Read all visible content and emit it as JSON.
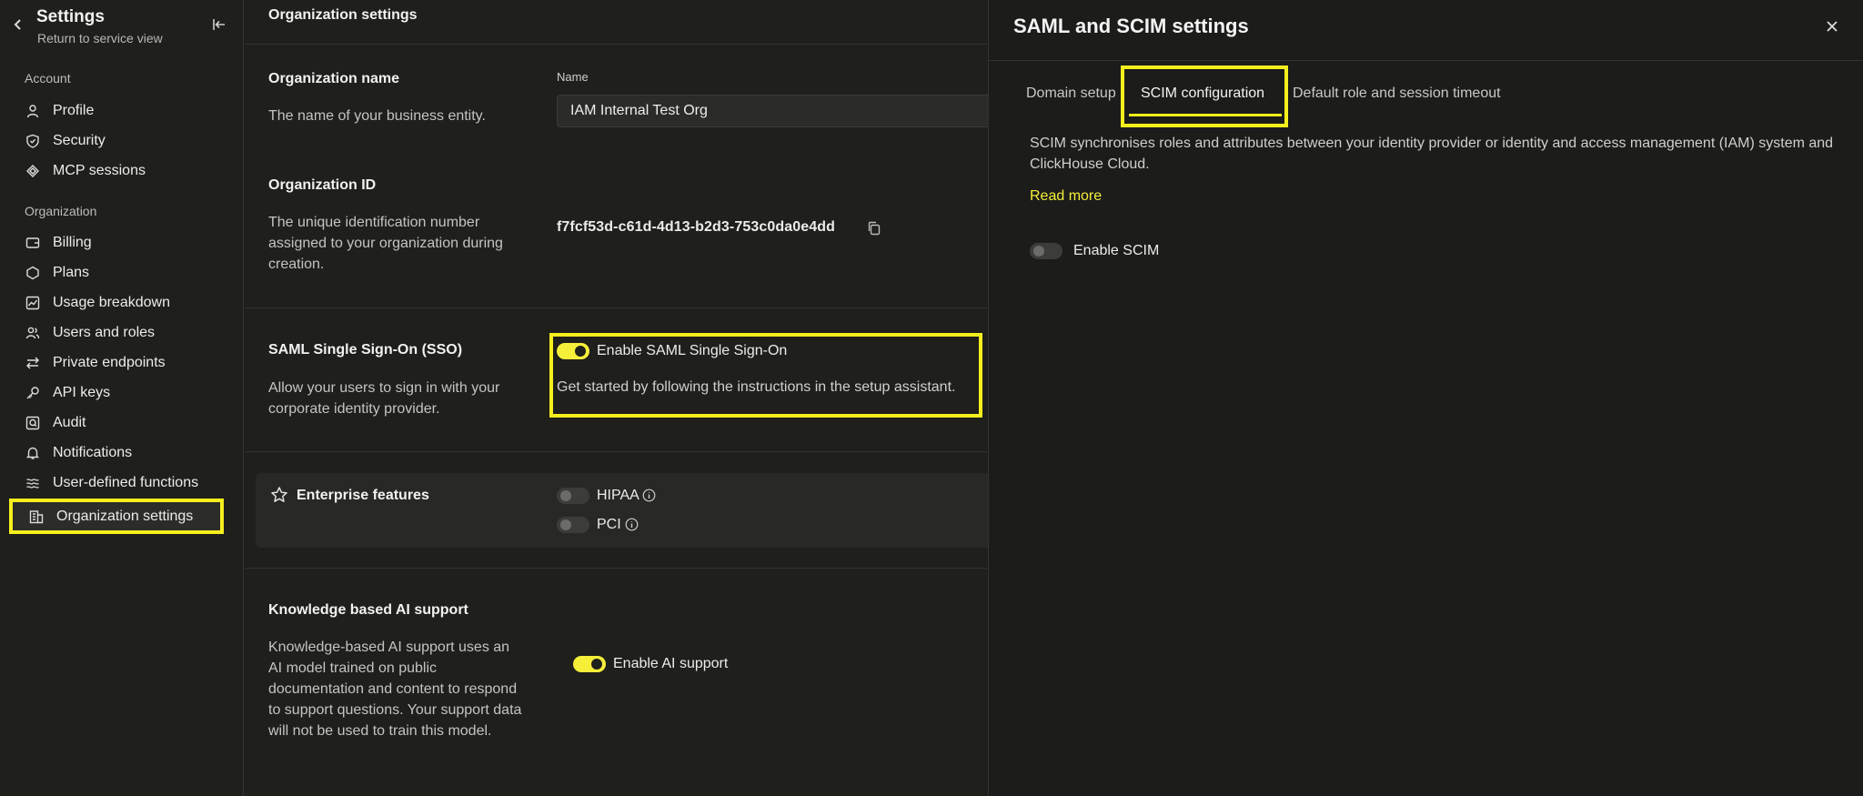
{
  "sidebar": {
    "title": "Settings",
    "subtitle": "Return to service view",
    "sections": {
      "account": "Account",
      "organization": "Organization"
    },
    "items": [
      {
        "label": "Profile",
        "icon": "user-icon"
      },
      {
        "label": "Security",
        "icon": "shield-icon"
      },
      {
        "label": "MCP sessions",
        "icon": "mcp-icon"
      },
      {
        "label": "Billing",
        "icon": "wallet-icon"
      },
      {
        "label": "Plans",
        "icon": "hexagon-icon"
      },
      {
        "label": "Usage breakdown",
        "icon": "chart-icon"
      },
      {
        "label": "Users and roles",
        "icon": "users-icon"
      },
      {
        "label": "Private endpoints",
        "icon": "arrows-icon"
      },
      {
        "label": "API keys",
        "icon": "key-icon"
      },
      {
        "label": "Audit",
        "icon": "audit-icon"
      },
      {
        "label": "Notifications",
        "icon": "bell-icon"
      },
      {
        "label": "User-defined functions",
        "icon": "waves-icon"
      },
      {
        "label": "Organization settings",
        "icon": "building-icon",
        "active": true
      }
    ]
  },
  "main": {
    "title": "Organization settings",
    "org_name": {
      "title": "Organization name",
      "desc": "The name of your business entity.",
      "field_label": "Name",
      "value": "IAM Internal Test Org"
    },
    "org_id": {
      "title": "Organization ID",
      "desc": "The unique identification number assigned to your organization during creation.",
      "value": "f7fcf53d-c61d-4d13-b2d3-753c0da0e4dd"
    },
    "sso": {
      "title": "SAML Single Sign-On (SSO)",
      "desc": "Allow your users to sign in with your corporate identity provider.",
      "toggle_label": "Enable SAML Single Sign-On",
      "toggle_on": true,
      "setup_text": "Get started by following the instructions in the setup assistant."
    },
    "enterprise": {
      "title": "Enterprise features",
      "hipaa": "HIPAA",
      "pci": "PCI"
    },
    "ai": {
      "title": "Knowledge based AI support",
      "desc": "Knowledge-based AI support uses an AI model trained on public documentation and content to respond to support questions. Your support data will not be used to train this model.",
      "toggle_label": "Enable AI support",
      "toggle_on": true
    }
  },
  "panel": {
    "title": "SAML and SCIM settings",
    "tabs": [
      "Domain setup",
      "SCIM configuration",
      "Default role and session timeout"
    ],
    "active_tab": "SCIM configuration",
    "desc": "SCIM synchronises roles and attributes between your identity provider or identity and access management (IAM) system and ClickHouse Cloud.",
    "read_more": "Read more",
    "toggle_label": "Enable SCIM",
    "toggle_on": false
  },
  "colors": {
    "accent": "#f5ef1e",
    "background": "#1f1f1c",
    "panel_background": "#1c1c1a"
  }
}
